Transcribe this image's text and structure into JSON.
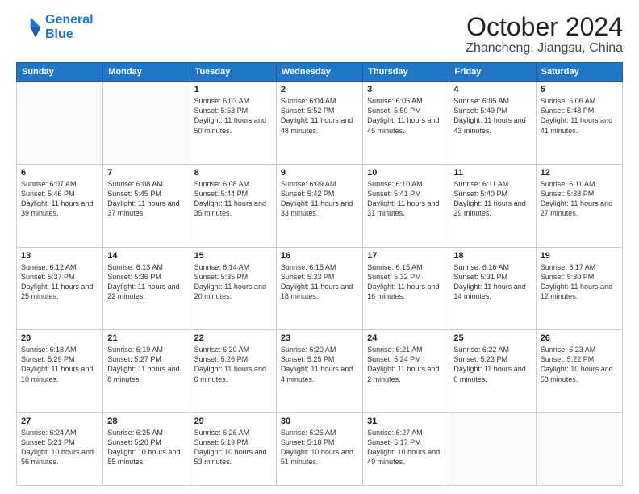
{
  "logo": {
    "line1": "General",
    "line2": "Blue"
  },
  "title": "October 2024",
  "subtitle": "Zhancheng, Jiangsu, China",
  "days": [
    "Sunday",
    "Monday",
    "Tuesday",
    "Wednesday",
    "Thursday",
    "Friday",
    "Saturday"
  ],
  "weeks": [
    [
      {
        "day": "",
        "empty": true
      },
      {
        "day": "",
        "empty": true
      },
      {
        "day": "1",
        "sunrise": "6:03 AM",
        "sunset": "5:53 PM",
        "daylight": "11 hours and 50 minutes."
      },
      {
        "day": "2",
        "sunrise": "6:04 AM",
        "sunset": "5:52 PM",
        "daylight": "11 hours and 48 minutes."
      },
      {
        "day": "3",
        "sunrise": "6:05 AM",
        "sunset": "5:50 PM",
        "daylight": "11 hours and 45 minutes."
      },
      {
        "day": "4",
        "sunrise": "6:05 AM",
        "sunset": "5:49 PM",
        "daylight": "11 hours and 43 minutes."
      },
      {
        "day": "5",
        "sunrise": "6:06 AM",
        "sunset": "5:48 PM",
        "daylight": "11 hours and 41 minutes."
      }
    ],
    [
      {
        "day": "6",
        "sunrise": "6:07 AM",
        "sunset": "5:46 PM",
        "daylight": "11 hours and 39 minutes."
      },
      {
        "day": "7",
        "sunrise": "6:08 AM",
        "sunset": "5:45 PM",
        "daylight": "11 hours and 37 minutes."
      },
      {
        "day": "8",
        "sunrise": "6:08 AM",
        "sunset": "5:44 PM",
        "daylight": "11 hours and 35 minutes."
      },
      {
        "day": "9",
        "sunrise": "6:09 AM",
        "sunset": "5:42 PM",
        "daylight": "11 hours and 33 minutes."
      },
      {
        "day": "10",
        "sunrise": "6:10 AM",
        "sunset": "5:41 PM",
        "daylight": "11 hours and 31 minutes."
      },
      {
        "day": "11",
        "sunrise": "6:11 AM",
        "sunset": "5:40 PM",
        "daylight": "11 hours and 29 minutes."
      },
      {
        "day": "12",
        "sunrise": "6:11 AM",
        "sunset": "5:38 PM",
        "daylight": "11 hours and 27 minutes."
      }
    ],
    [
      {
        "day": "13",
        "sunrise": "6:12 AM",
        "sunset": "5:37 PM",
        "daylight": "11 hours and 25 minutes."
      },
      {
        "day": "14",
        "sunrise": "6:13 AM",
        "sunset": "5:36 PM",
        "daylight": "11 hours and 22 minutes."
      },
      {
        "day": "15",
        "sunrise": "6:14 AM",
        "sunset": "5:35 PM",
        "daylight": "11 hours and 20 minutes."
      },
      {
        "day": "16",
        "sunrise": "6:15 AM",
        "sunset": "5:33 PM",
        "daylight": "11 hours and 18 minutes."
      },
      {
        "day": "17",
        "sunrise": "6:15 AM",
        "sunset": "5:32 PM",
        "daylight": "11 hours and 16 minutes."
      },
      {
        "day": "18",
        "sunrise": "6:16 AM",
        "sunset": "5:31 PM",
        "daylight": "11 hours and 14 minutes."
      },
      {
        "day": "19",
        "sunrise": "6:17 AM",
        "sunset": "5:30 PM",
        "daylight": "11 hours and 12 minutes."
      }
    ],
    [
      {
        "day": "20",
        "sunrise": "6:18 AM",
        "sunset": "5:29 PM",
        "daylight": "11 hours and 10 minutes."
      },
      {
        "day": "21",
        "sunrise": "6:19 AM",
        "sunset": "5:27 PM",
        "daylight": "11 hours and 8 minutes."
      },
      {
        "day": "22",
        "sunrise": "6:20 AM",
        "sunset": "5:26 PM",
        "daylight": "11 hours and 6 minutes."
      },
      {
        "day": "23",
        "sunrise": "6:20 AM",
        "sunset": "5:25 PM",
        "daylight": "11 hours and 4 minutes."
      },
      {
        "day": "24",
        "sunrise": "6:21 AM",
        "sunset": "5:24 PM",
        "daylight": "11 hours and 2 minutes."
      },
      {
        "day": "25",
        "sunrise": "6:22 AM",
        "sunset": "5:23 PM",
        "daylight": "11 hours and 0 minutes."
      },
      {
        "day": "26",
        "sunrise": "6:23 AM",
        "sunset": "5:22 PM",
        "daylight": "10 hours and 58 minutes."
      }
    ],
    [
      {
        "day": "27",
        "sunrise": "6:24 AM",
        "sunset": "5:21 PM",
        "daylight": "10 hours and 56 minutes."
      },
      {
        "day": "28",
        "sunrise": "6:25 AM",
        "sunset": "5:20 PM",
        "daylight": "10 hours and 55 minutes."
      },
      {
        "day": "29",
        "sunrise": "6:26 AM",
        "sunset": "5:19 PM",
        "daylight": "10 hours and 53 minutes."
      },
      {
        "day": "30",
        "sunrise": "6:26 AM",
        "sunset": "5:18 PM",
        "daylight": "10 hours and 51 minutes."
      },
      {
        "day": "31",
        "sunrise": "6:27 AM",
        "sunset": "5:17 PM",
        "daylight": "10 hours and 49 minutes."
      },
      {
        "day": "",
        "empty": true
      },
      {
        "day": "",
        "empty": true
      }
    ]
  ]
}
